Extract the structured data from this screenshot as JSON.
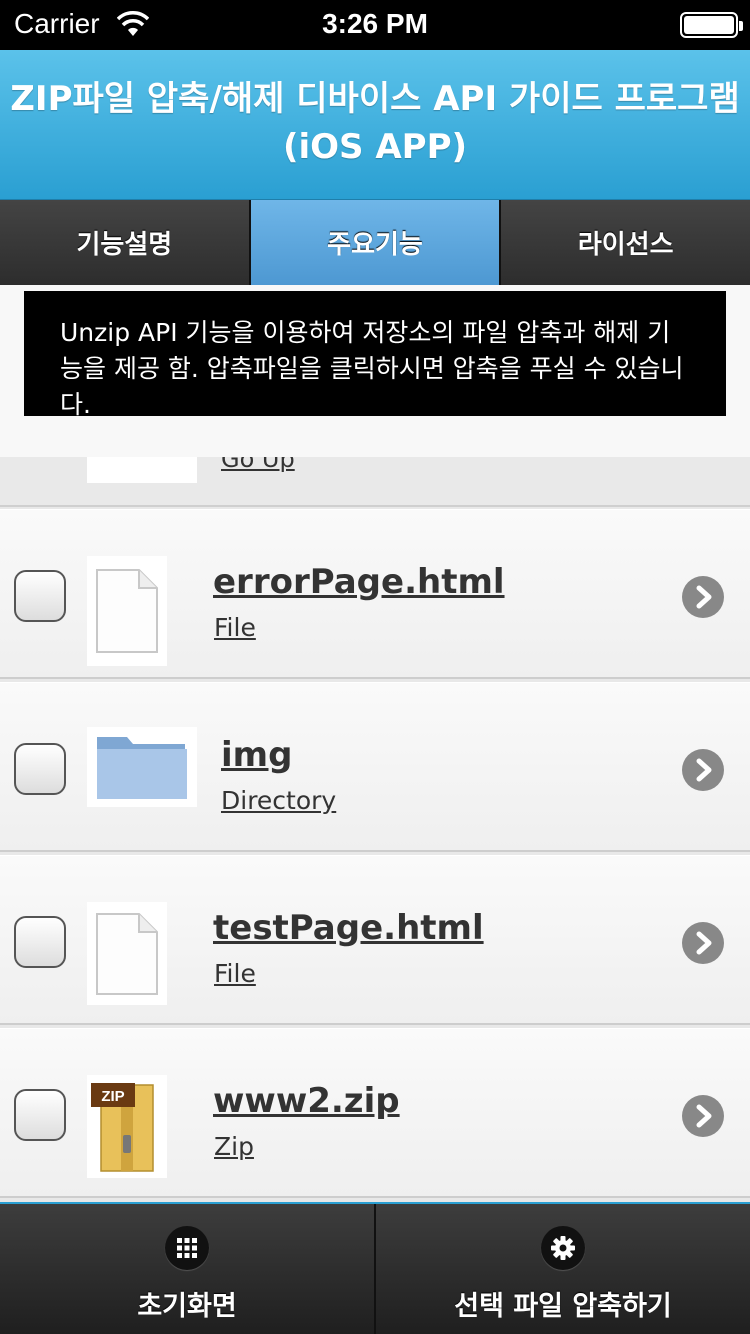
{
  "status_bar": {
    "carrier": "Carrier",
    "time": "3:26 PM"
  },
  "header": {
    "title_line1": "ZIP파일 압축/해제 디바이스 API 가이드 프로그램",
    "title_line2": "(iOS APP)"
  },
  "tabs": [
    {
      "label": "기능설명",
      "active": false
    },
    {
      "label": "주요기능",
      "active": true
    },
    {
      "label": "라이선스",
      "active": false
    }
  ],
  "tooltip": {
    "text": "Unzip API 기능을 이용하여 저장소의 파일 압축과 해제 기능을 제공 함. 압축파일을 클릭하시면 압축을 푸실 수 있습니다."
  },
  "go_up": {
    "label": "Go Up"
  },
  "files": [
    {
      "name": "errorPage.html",
      "type": "File",
      "icon": "file-icon"
    },
    {
      "name": "img",
      "type": "Directory",
      "icon": "folder-icon"
    },
    {
      "name": "testPage.html",
      "type": "File",
      "icon": "file-icon"
    },
    {
      "name": "www2.zip",
      "type": "Zip",
      "icon": "zip-icon",
      "badge": "ZIP"
    }
  ],
  "bottom_bar": {
    "home_label": "초기화면",
    "home_icon": "grid-icon",
    "compress_label": "선택 파일 압축하기",
    "compress_icon": "gear-icon"
  },
  "colors": {
    "header": "#2a9fd2",
    "active_tab": "#5aa6dd",
    "bar": "#2d2d2d"
  }
}
